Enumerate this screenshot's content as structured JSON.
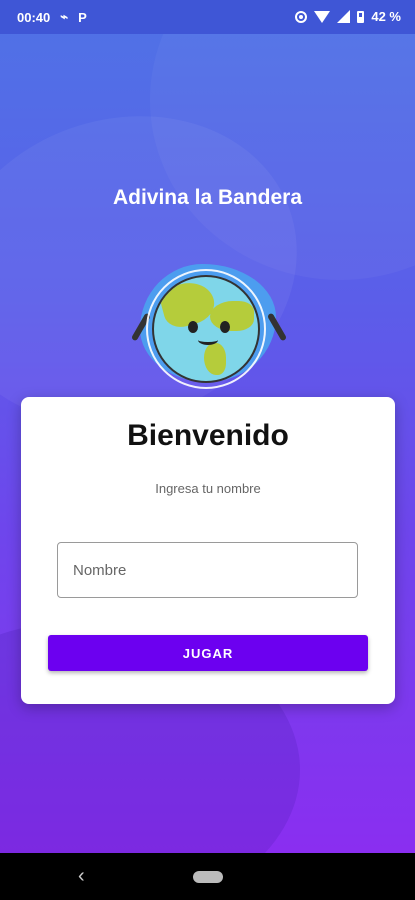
{
  "status_bar": {
    "time": "00:40",
    "battery_text": "42 %",
    "icons": [
      "usb-icon",
      "p-icon",
      "vibrate-icon",
      "wifi-icon",
      "signal-icon",
      "battery-icon"
    ]
  },
  "app": {
    "title": "Adivina la Bandera"
  },
  "card": {
    "heading": "Bienvenido",
    "subtitle": "Ingresa tu nombre",
    "name_placeholder": "Nombre",
    "name_value": "",
    "play_label": "JUGAR"
  },
  "colors": {
    "primary": "#6c00f0",
    "gradient_top": "#4f73e6",
    "gradient_bottom": "#8a2ef0"
  }
}
